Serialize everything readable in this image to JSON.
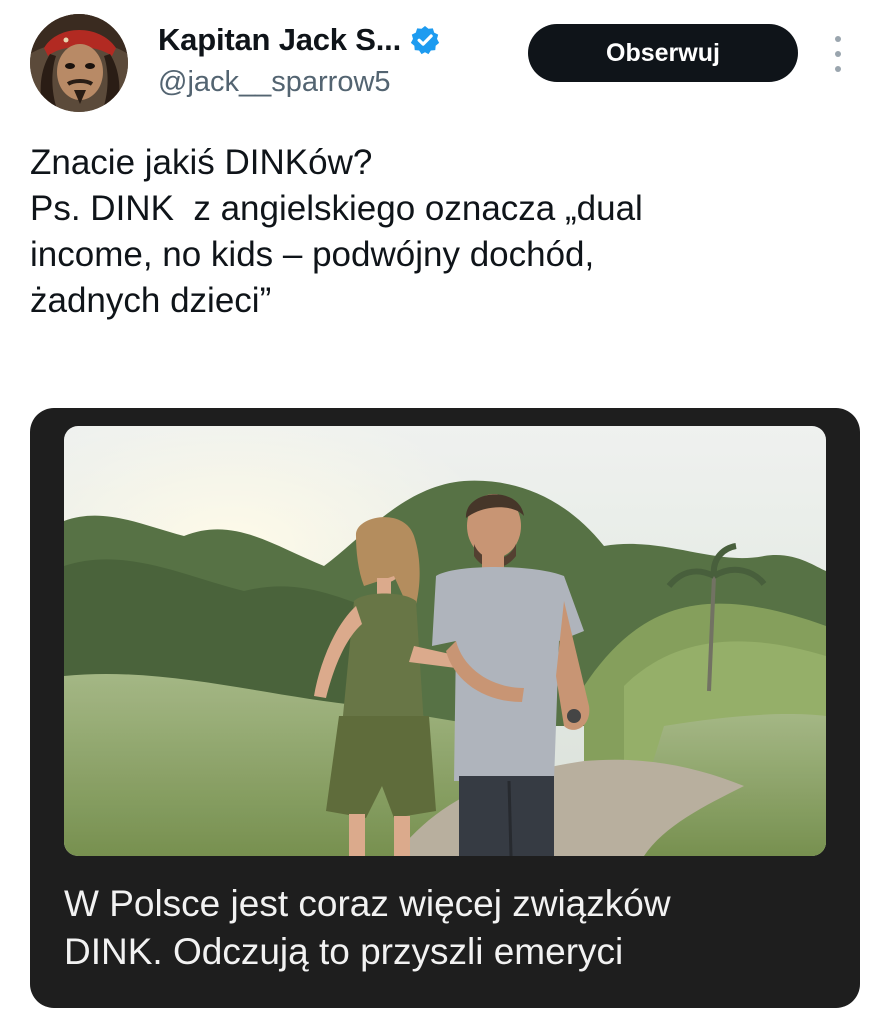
{
  "author": {
    "display_name": "Kapitan Jack S...",
    "handle": "@jack__sparrow5",
    "verified_icon": "verified-badge-icon",
    "avatar_icon": "profile-avatar"
  },
  "follow_button": {
    "label": "Obserwuj"
  },
  "more_menu": {
    "icon": "more-vertical-icon"
  },
  "tweet": {
    "lines": [
      "Znacie jakiś DINKów?",
      "Ps. DINK  z angielskiego oznacza „dual",
      "income, no kids – podwójny dochód,",
      "żadnych dzieci”"
    ]
  },
  "card": {
    "headline_lines": [
      "W Polsce jest coraz więcej związków",
      "DINK. Odczują to przyszli emeryci"
    ],
    "image_icon": "couple-walking-photo"
  },
  "colors": {
    "text": "#0f1419",
    "secondary": "#536471",
    "verified": "#1d9bf0",
    "button_bg": "#0f1419",
    "card_bg": "#1e1e1e"
  }
}
